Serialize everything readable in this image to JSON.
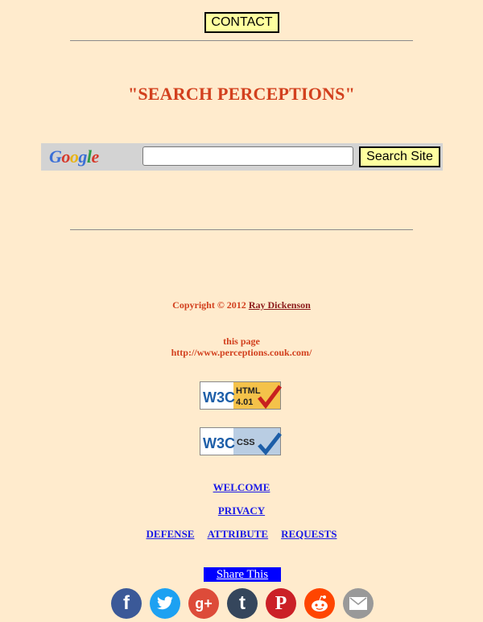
{
  "header": {
    "contact_label": "CONTACT"
  },
  "main": {
    "title": "\"SEARCH PERCEPTIONS\""
  },
  "search": {
    "logo_text": "Google",
    "input_value": "",
    "button_label": "Search Site"
  },
  "footer": {
    "copyright_prefix": "Copyright © 2012",
    "author_link": "Ray Dickenson",
    "this_page_label": "this page",
    "this_page_url": "http://www.perceptions.couk.com/",
    "badge_html_w3c": "W3C",
    "badge_html_text": "HTML",
    "badge_html_version": "4.01",
    "badge_css_w3c": "W3C",
    "badge_css_text": "CSS"
  },
  "nav": {
    "welcome": "WELCOME",
    "privacy": "PRIVACY",
    "defense": "DEFENSE",
    "attribute": "ATTRIBUTE",
    "requests": "REQUESTS"
  },
  "share": {
    "label": "Share This",
    "icons": [
      "facebook-icon",
      "twitter-icon",
      "google-plus-icon",
      "tumblr-icon",
      "pinterest-icon",
      "reddit-icon",
      "email-icon"
    ],
    "facebook_glyph": "f",
    "googleplus_glyph": "g+",
    "tumblr_glyph": "t",
    "pinterest_glyph": "P"
  },
  "colors": {
    "background": "#FFEBCD",
    "title": "#D2401E",
    "button_yellow": "#FFFFA0",
    "link_blue": "#1A1AE6",
    "share_blue": "#0000FF",
    "facebook": "#3B5998",
    "twitter": "#1DA1F2",
    "google_plus": "#DD4B39",
    "tumblr": "#35465C",
    "pinterest": "#CB2027",
    "reddit": "#FF4500",
    "email": "#999999"
  }
}
